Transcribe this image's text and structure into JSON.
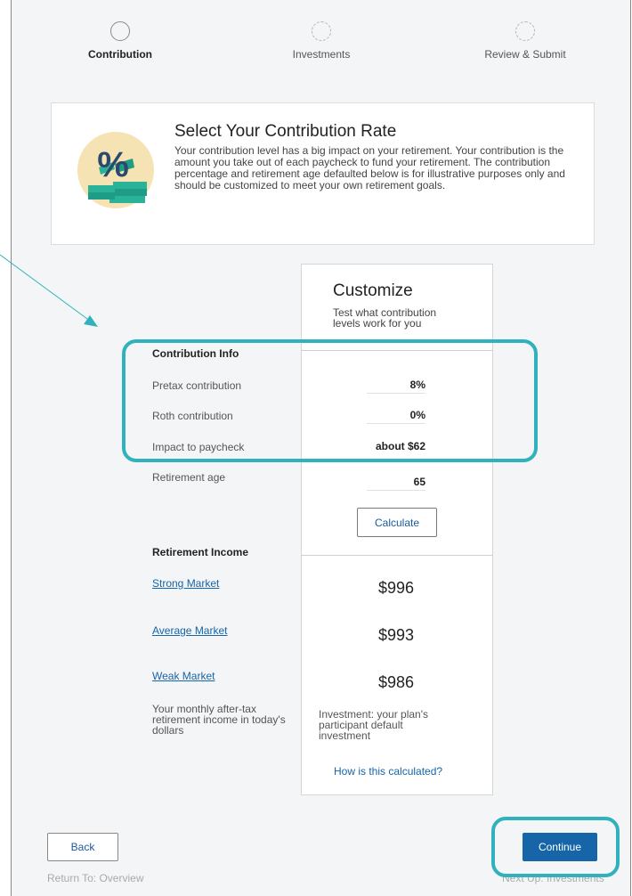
{
  "steps": [
    {
      "label": "Contribution",
      "state": "active"
    },
    {
      "label": "Investments",
      "state": "pending"
    },
    {
      "label": "Review & Submit",
      "state": "pending"
    }
  ],
  "header": {
    "title": "Select Your Contribution Rate",
    "description": "Your contribution level has a big impact on your retirement. Your contribution is the amount you take out of each paycheck to fund your retirement. The contribution percentage and retirement age defaulted below is for illustrative purposes only and should be customized to meet your own retirement goals.",
    "illustration_icon": "percent-money-stack-icon",
    "illustration_symbol": "%"
  },
  "customize": {
    "title": "Customize",
    "subtitle": "Test what contribution levels work for you"
  },
  "contribution_info": {
    "heading": "Contribution Info",
    "pretax_label": "Pretax contribution",
    "pretax_value": "8%",
    "roth_label": "Roth contribution",
    "roth_value": "0%",
    "impact_label": "Impact to paycheck",
    "impact_value": "about $62",
    "retirement_age_label": "Retirement age",
    "retirement_age_value": "65"
  },
  "calculate_label": "Calculate",
  "retirement_income": {
    "heading": "Retirement Income",
    "strong_label": "Strong Market",
    "strong_value": "$996",
    "average_label": "Average Market",
    "average_value": "$993",
    "weak_label": "Weak Market",
    "weak_value": "$986",
    "note_left": "Your monthly after-tax retirement income in today's dollars",
    "note_right": "Investment: your plan's participant default investment",
    "how_link": "How is this calculated?"
  },
  "footer": {
    "back_label": "Back",
    "return_text": "Return To: Overview",
    "continue_label": "Continue",
    "next_text": "Next Up: Investments"
  },
  "colors": {
    "accent_blue": "#1565a8",
    "highlight_teal": "#2fb2bd",
    "illustration_bg": "#f6e3b4",
    "money_green": "#2bb39a"
  }
}
